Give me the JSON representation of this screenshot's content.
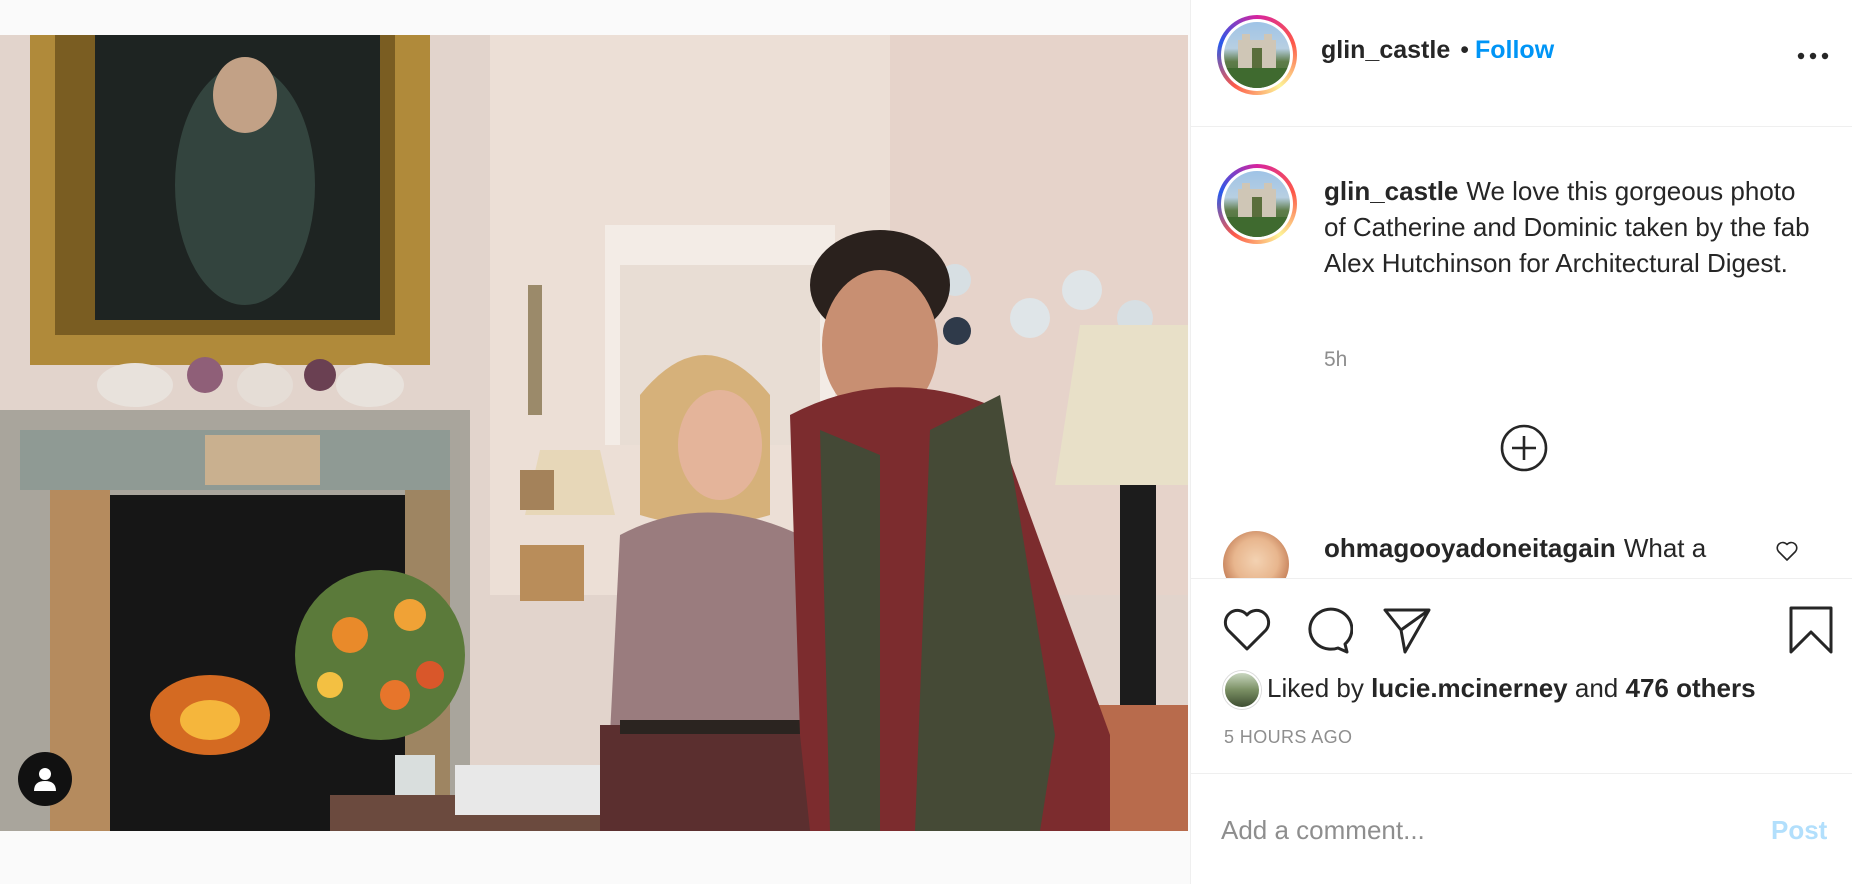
{
  "post": {
    "author": "glin_castle",
    "header_separator": "•",
    "follow_label": "Follow",
    "more_icon": "more-options-icon",
    "caption": "We love this gorgeous photo of Catherine and Dominic taken by the fab Alex Hutchinson for Architectural Digest.",
    "caption_time": "5h",
    "load_more_icon": "plus-circle-icon"
  },
  "comments": [
    {
      "author": "ohmagooyadoneitagain",
      "text": "What a"
    }
  ],
  "actions": {
    "like_icon": "heart-icon",
    "comment_icon": "speech-bubble-icon",
    "share_icon": "paper-plane-icon",
    "save_icon": "bookmark-icon"
  },
  "likes": {
    "prefix": "Liked by",
    "user": "lucie.mcinerney",
    "conjunction": "and",
    "others": "476 others"
  },
  "timestamp": "5 HOURS AGO",
  "comment_box": {
    "placeholder": "Add a comment...",
    "post_label": "Post"
  },
  "colors": {
    "accent": "#0095f6",
    "post_disabled": "#b2dffc",
    "secondary_text": "#8e8e8e",
    "primary_text": "#262626"
  }
}
